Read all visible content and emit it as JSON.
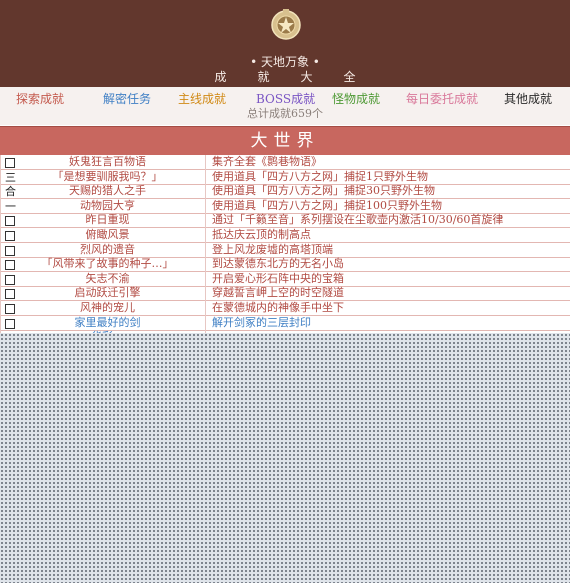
{
  "header": {
    "subtitle": "• 天地万象 •",
    "title": "成就大全",
    "colors": {
      "background": "#62372d",
      "text": "#f4e9e4"
    }
  },
  "tabs": [
    {
      "label": "探索成就",
      "color": "#c45a4e"
    },
    {
      "label": "解密任务",
      "color": "#3f7fc4"
    },
    {
      "label": "主线成就",
      "color": "#d18a16"
    },
    {
      "label": "BOSS成就",
      "color": "#7a55c4"
    },
    {
      "label": "怪物成就",
      "color": "#4f9a36"
    },
    {
      "label": "每日委托成就",
      "color": "#d9789a"
    },
    {
      "label": "其他成就",
      "color": "#2a2a2a"
    }
  ],
  "total_label": "总计成就659个",
  "region": {
    "title": "大世界"
  },
  "rows": [
    {
      "mark": "",
      "name": "妖鬼狂言百物语",
      "desc": "集齐全套《鹮巷物语》",
      "name_color": "#b14a42",
      "desc_color": "#b14a42"
    },
    {
      "mark": "三",
      "name": "「是想要驯服我吗？」",
      "desc": "使用道具「四方八方之网」捕捉1只野外生物",
      "name_color": "#b14a42",
      "desc_color": "#b14a42"
    },
    {
      "mark": "合",
      "name": "天赐的猎人之手",
      "desc": "使用道具「四方八方之网」捕捉30只野外生物",
      "name_color": "#b14a42",
      "desc_color": "#b14a42"
    },
    {
      "mark": "一",
      "name": "动物园大亨",
      "desc": "使用道具「四方八方之网」捕捉100只野外生物",
      "name_color": "#b14a42",
      "desc_color": "#b14a42"
    },
    {
      "mark": "",
      "name": "昨日重现",
      "desc": "通过「千籁至音」系列摆设在尘歌壶内激活10/30/60首旋律",
      "name_color": "#b14a42",
      "desc_color": "#b14a42"
    },
    {
      "mark": "",
      "name": "俯瞰风景",
      "desc": "抵达庆云顶的制高点",
      "name_color": "#b14a42",
      "desc_color": "#b14a42"
    },
    {
      "mark": "",
      "name": "烈风的遗音",
      "desc": "登上风龙废墟的高塔顶端",
      "name_color": "#b14a42",
      "desc_color": "#b14a42"
    },
    {
      "mark": "",
      "name": "「风带来了故事的种子…」",
      "desc": "到达蒙德东北方的无名小岛",
      "name_color": "#b14a42",
      "desc_color": "#b14a42"
    },
    {
      "mark": "",
      "name": "矢志不渝",
      "desc": "开启爱心形石阵中央的宝箱",
      "name_color": "#b14a42",
      "desc_color": "#b14a42"
    },
    {
      "mark": "",
      "name": "启动跃迁引擎",
      "desc": "穿越誓言岬上空的时空隧道",
      "name_color": "#b14a42",
      "desc_color": "#b14a42"
    },
    {
      "mark": "",
      "name": "风神的宠儿",
      "desc": "在蒙德城内的神像手中坐下",
      "name_color": "#b14a42",
      "desc_color": "#b14a42"
    },
    {
      "mark": "",
      "name": "家里最好的剑",
      "desc": "解开剑冢的三层封印",
      "name_color": "#3f7fc4",
      "desc_color": "#3f7fc4"
    },
    {
      "mark": "",
      "name": "华彩…",
      "desc": "",
      "name_color": "#3f7fc4",
      "desc_color": "#3f7fc4"
    }
  ]
}
